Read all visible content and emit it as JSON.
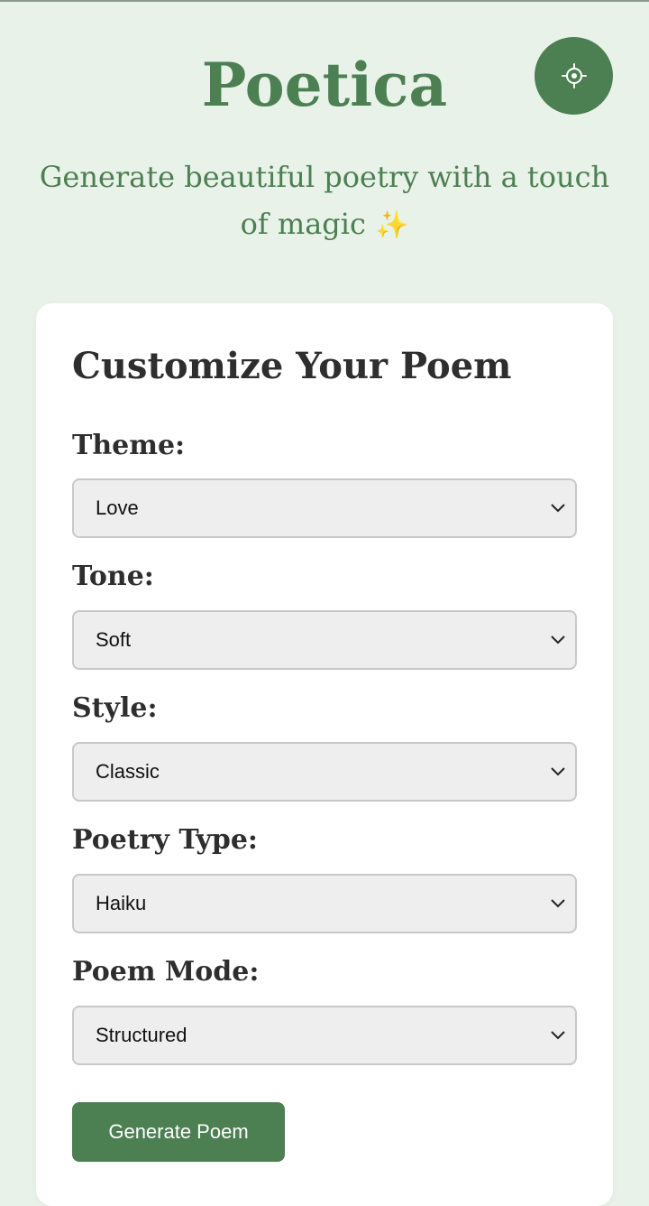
{
  "header": {
    "title": "Poetica",
    "tagline": "Generate beautiful poetry with a touch of magic",
    "tagline_emoji": "✨",
    "theme_toggle_icon": "sun-icon"
  },
  "form": {
    "heading": "Customize Your Poem",
    "fields": [
      {
        "label": "Theme:",
        "value": "Love"
      },
      {
        "label": "Tone:",
        "value": "Soft"
      },
      {
        "label": "Style:",
        "value": "Classic"
      },
      {
        "label": "Poetry Type:",
        "value": "Haiku"
      },
      {
        "label": "Poem Mode:",
        "value": "Structured"
      }
    ],
    "submit_label": "Generate Poem"
  },
  "colors": {
    "accent": "#4c7f52",
    "background": "#e8f2e9",
    "card": "#ffffff",
    "select_bg": "#eeeeee",
    "text": "#2e2e2e"
  }
}
